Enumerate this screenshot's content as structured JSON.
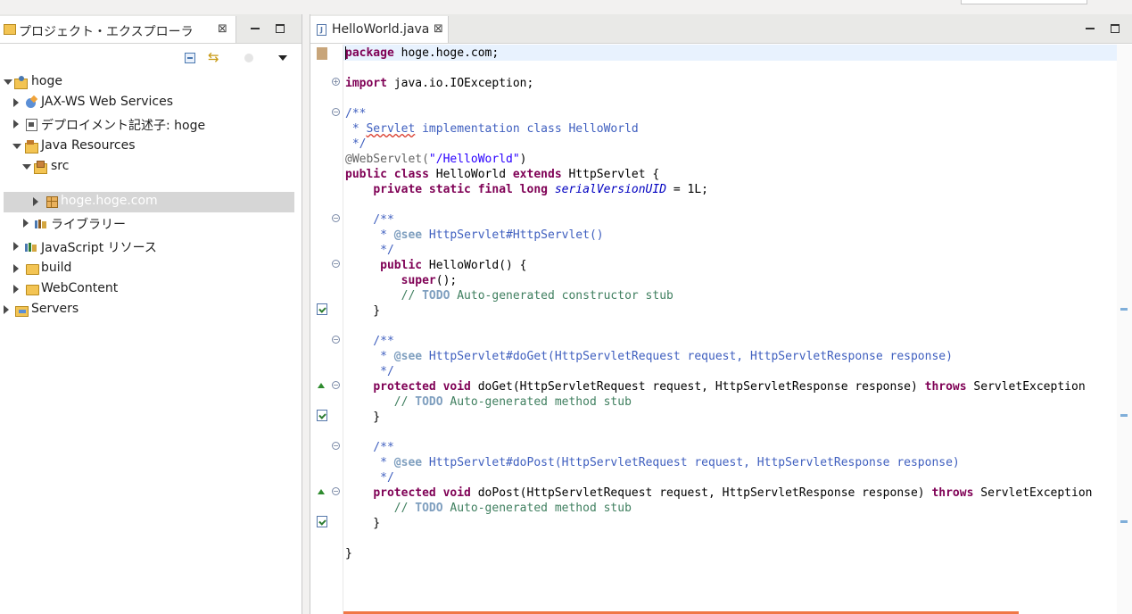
{
  "left_view": {
    "tab_title": "プロジェクト・エクスプローラ",
    "close_glyph": "⊠",
    "tree": [
      {
        "label": "hoge",
        "icon": "project-icon",
        "expanded": true
      },
      {
        "label": "JAX-WS Web Services",
        "icon": "webservices-icon"
      },
      {
        "label": "デプロイメント記述子: hoge",
        "icon": "deployment-descriptor-icon"
      },
      {
        "label": "Java Resources",
        "icon": "java-resources-icon",
        "expanded": true
      },
      {
        "label": "src",
        "icon": "source-folder-icon",
        "expanded": true
      },
      {
        "label": "hoge.hoge.com",
        "icon": "package-icon",
        "selected": true
      },
      {
        "label": "ライブラリー",
        "icon": "library-icon"
      },
      {
        "label": "JavaScript リソース",
        "icon": "javascript-resources-icon"
      },
      {
        "label": "build",
        "icon": "folder-icon"
      },
      {
        "label": "WebContent",
        "icon": "folder-icon"
      },
      {
        "label": "Servers",
        "icon": "folder-icon"
      }
    ]
  },
  "editor": {
    "tab_title": "HelloWorld.java",
    "close_glyph": "⊠",
    "code": {
      "l1a": "package",
      "l1b": " hoge.hoge.com;",
      "l2a": "import",
      "l2b": " java.io.IOException;",
      "l3": "/**",
      "l4a": " * ",
      "l4b": "Servlet",
      "l4c": " implementation class HelloWorld",
      "l5": " */",
      "l6a": "@WebServlet(",
      "l6b": "\"/HelloWorld\"",
      "l6c": ")",
      "l7a": "public",
      "l7b": " ",
      "l7c": "class",
      "l7d": " HelloWorld ",
      "l7e": "extends",
      "l7f": " HttpServlet {",
      "l8a": "    ",
      "l8b": "private static final long",
      "l8c": " ",
      "l8d": "serialVersionUID",
      "l8e": " = 1L;",
      "l9": "    /**",
      "l10a": "     * ",
      "l10b": "@see",
      "l10c": " HttpServlet#HttpServlet()",
      "l11": "     */",
      "l12a": "     ",
      "l12b": "public",
      "l12c": " HelloWorld() {",
      "l13a": "        ",
      "l13b": "super",
      "l13c": "();",
      "l14a": "        // ",
      "l14b": "TODO",
      "l14c": " Auto-generated constructor stub",
      "l15": "    }",
      "l16": "    /**",
      "l17a": "     * ",
      "l17b": "@see",
      "l17c": " HttpServlet#doGet(HttpServletRequest request, HttpServletResponse response)",
      "l18": "     */",
      "l19a": "    ",
      "l19b": "protected void",
      "l19c": " doGet(HttpServletRequest request, HttpServletResponse response) ",
      "l19d": "throws",
      "l19e": " ServletException",
      "l20a": "       // ",
      "l20b": "TODO",
      "l20c": " Auto-generated method stub",
      "l21": "    }",
      "l22": "    /**",
      "l23a": "     * ",
      "l23b": "@see",
      "l23c": " HttpServlet#doPost(HttpServletRequest request, HttpServletResponse response)",
      "l24": "     */",
      "l25a": "    ",
      "l25b": "protected void",
      "l25c": " doPost(HttpServletRequest request, HttpServletResponse response) ",
      "l25d": "throws",
      "l25e": " ServletException",
      "l26a": "       // ",
      "l26b": "TODO",
      "l26c": " Auto-generated method stub",
      "l27": "    }",
      "l28": "}"
    }
  },
  "colors": {
    "keyword": "#7f0055",
    "javadoc": "#3f5fbf",
    "comment": "#3f7f5f",
    "string": "#2a00ff",
    "field": "#0000c0",
    "current_line": "#e8f2fe",
    "selection": "#d6d6d6",
    "accent_orange": "#f07746"
  }
}
